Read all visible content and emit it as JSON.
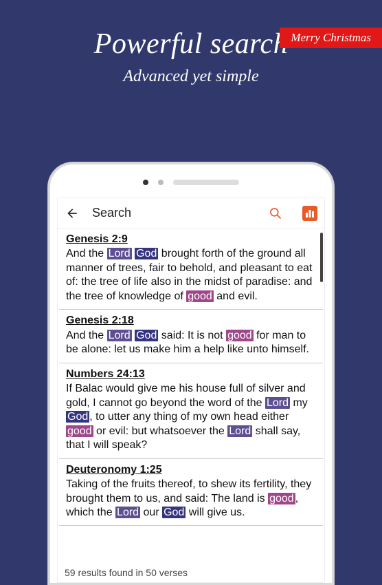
{
  "badge": "Merry Christmas",
  "hero": {
    "title": "Powerful search",
    "subtitle": "Advanced yet simple"
  },
  "app": {
    "screen_title": "Search"
  },
  "highlight_colors": {
    "lord": "#5e4f92",
    "god": "#37347f",
    "good": "#a0478c"
  },
  "results": [
    {
      "ref": "Genesis 2:9",
      "parts": [
        {
          "t": "And the "
        },
        {
          "t": "Lord",
          "h": "c1"
        },
        {
          "t": " "
        },
        {
          "t": "God",
          "h": "c2"
        },
        {
          "t": " brought forth of the ground all manner of trees, fair to behold, and pleasant to eat of: the tree of life also in the midst of paradise: and the tree of knowledge of "
        },
        {
          "t": "good",
          "h": "c3"
        },
        {
          "t": " and evil."
        }
      ]
    },
    {
      "ref": "Genesis 2:18",
      "parts": [
        {
          "t": "And the "
        },
        {
          "t": "Lord",
          "h": "c1"
        },
        {
          "t": " "
        },
        {
          "t": "God",
          "h": "c2"
        },
        {
          "t": " said: It is not "
        },
        {
          "t": "good",
          "h": "c3"
        },
        {
          "t": " for man to be alone: let us make him a help like unto himself."
        }
      ]
    },
    {
      "ref": "Numbers 24:13",
      "parts": [
        {
          "t": "If Balac would give me his house full of silver and gold, I cannot go beyond the word of the "
        },
        {
          "t": "Lord",
          "h": "c1"
        },
        {
          "t": " my "
        },
        {
          "t": "God",
          "h": "c2"
        },
        {
          "t": ", to utter any thing of my own head either "
        },
        {
          "t": "good",
          "h": "c3"
        },
        {
          "t": " or evil: but whatsoever the "
        },
        {
          "t": "Lord",
          "h": "c1"
        },
        {
          "t": " shall say, that I will speak?"
        }
      ]
    },
    {
      "ref": "Deuteronomy 1:25",
      "parts": [
        {
          "t": "Taking of the fruits thereof, to shew its fertility, they brought them to us, and said: The land is "
        },
        {
          "t": "good",
          "h": "c3"
        },
        {
          "t": ", which the "
        },
        {
          "t": "Lord",
          "h": "c1"
        },
        {
          "t": " our "
        },
        {
          "t": "God",
          "h": "c2"
        },
        {
          "t": " will give us."
        }
      ]
    }
  ],
  "footer": "59 results found in 50 verses"
}
